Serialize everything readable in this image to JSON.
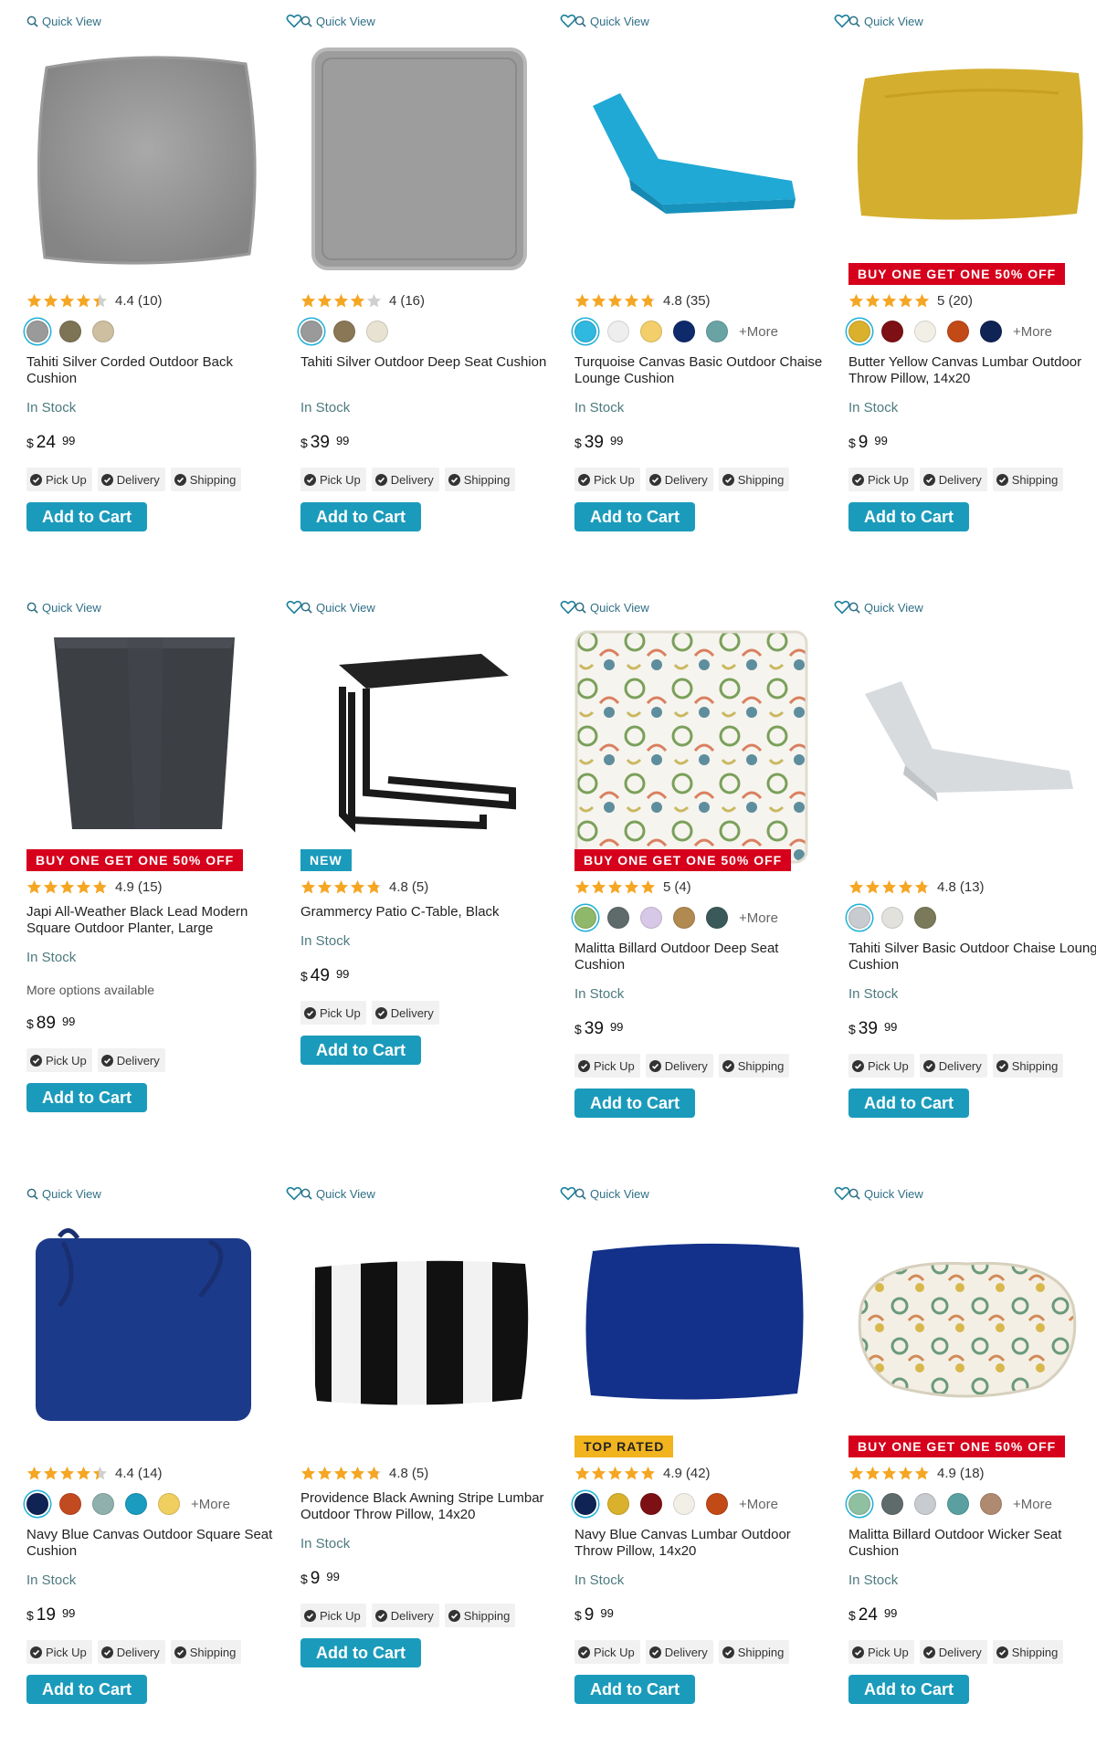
{
  "common": {
    "quick_view": "Quick View",
    "add_to_cart": "Add to Cart",
    "more_link": "+More",
    "in_stock": "In Stock",
    "currency": "$",
    "pick_up": "Pick Up",
    "delivery": "Delivery",
    "shipping": "Shipping"
  },
  "colors": {
    "accent": "#1b9bbb",
    "link": "#2f6f86",
    "badge_red": "#d6001c",
    "badge_gold": "#f2b41e",
    "star": "#f5a623"
  },
  "products": [
    {
      "name": "Tahiti Silver Corded Outdoor Back Cushion",
      "rating": 4.4,
      "rating_text": "4.4",
      "reviews": "(10)",
      "badge": "",
      "swatches": [
        "#9a9a9a",
        "#7d7456",
        "#cdbf9f"
      ],
      "has_more": false,
      "stock": "In Stock",
      "extra": "",
      "price_dollars": "24",
      "price_cents": "99",
      "fulfillment": [
        "pick_up",
        "delivery",
        "shipping"
      ],
      "icon": "silver-cushion-image"
    },
    {
      "name": "Tahiti Silver Outdoor Deep Seat Cushion",
      "rating": 4.0,
      "rating_text": "4",
      "reviews": "(16)",
      "badge": "",
      "swatches": [
        "#9a9a9a",
        "#8a7756",
        "#e8e2d2"
      ],
      "has_more": false,
      "stock": "In Stock",
      "extra": "",
      "price_dollars": "39",
      "price_cents": "99",
      "fulfillment": [
        "pick_up",
        "delivery",
        "shipping"
      ],
      "icon": "seat-cushion-image"
    },
    {
      "name": "Turquoise Canvas Basic Outdoor Chaise Lounge Cushion",
      "rating": 4.8,
      "rating_text": "4.8",
      "reviews": "(35)",
      "badge": "",
      "swatches": [
        "#2fb8e0",
        "#eeeeee",
        "#f2cf6a",
        "#0f2a6b",
        "#6aa3a3"
      ],
      "has_more": true,
      "stock": "In Stock",
      "extra": "",
      "price_dollars": "39",
      "price_cents": "99",
      "fulfillment": [
        "pick_up",
        "delivery",
        "shipping"
      ],
      "icon": "chaise-cushion-image"
    },
    {
      "name": "Butter Yellow Canvas Lumbar Outdoor Throw Pillow, 14x20",
      "rating": 5.0,
      "rating_text": "5",
      "reviews": "(20)",
      "badge": "BUY ONE GET ONE 50% OFF",
      "badge_style": "red",
      "swatches": [
        "#d9b12c",
        "#7d1014",
        "#f2f0e6",
        "#c24a17",
        "#0f2354"
      ],
      "has_more": true,
      "stock": "In Stock",
      "extra": "",
      "price_dollars": "9",
      "price_cents": "99",
      "fulfillment": [
        "pick_up",
        "delivery",
        "shipping"
      ],
      "icon": "lumbar-pillow-image"
    },
    {
      "name": "Japi All-Weather Black Lead Modern Square Outdoor Planter, Large",
      "rating": 4.9,
      "rating_text": "4.9",
      "reviews": "(15)",
      "badge": "BUY ONE GET ONE 50% OFF",
      "badge_style": "red",
      "swatches": [],
      "has_more": false,
      "stock": "In Stock",
      "extra": "More options available",
      "price_dollars": "89",
      "price_cents": "99",
      "fulfillment": [
        "pick_up",
        "delivery"
      ],
      "icon": "planter-image"
    },
    {
      "name": "Grammercy Patio C-Table, Black",
      "rating": 4.8,
      "rating_text": "4.8",
      "reviews": "(5)",
      "badge": "NEW",
      "badge_style": "teal",
      "swatches": [],
      "has_more": false,
      "stock": "In Stock",
      "extra": "",
      "price_dollars": "49",
      "price_cents": "99",
      "fulfillment": [
        "pick_up",
        "delivery"
      ],
      "icon": "c-table-image"
    },
    {
      "name": "Malitta Billard Outdoor Deep Seat Cushion",
      "rating": 5.0,
      "rating_text": "5",
      "reviews": "(4)",
      "badge": "BUY ONE GET ONE 50% OFF",
      "badge_style": "red",
      "swatches": [
        "#8fb86a",
        "#5f6b6b",
        "#d8c8e8",
        "#b08a50",
        "#3a5a5a"
      ],
      "has_more": true,
      "stock": "In Stock",
      "extra": "",
      "price_dollars": "39",
      "price_cents": "99",
      "fulfillment": [
        "pick_up",
        "delivery",
        "shipping"
      ],
      "icon": "pattern-cushion-image"
    },
    {
      "name": "Tahiti Silver Basic Outdoor Chaise Lounge Cushion",
      "rating": 4.8,
      "rating_text": "4.8",
      "reviews": "(13)",
      "badge": "",
      "swatches": [
        "#c8ccd0",
        "#e2e1dc",
        "#7a7a5a"
      ],
      "has_more": false,
      "stock": "In Stock",
      "extra": "",
      "price_dollars": "39",
      "price_cents": "99",
      "fulfillment": [
        "pick_up",
        "delivery",
        "shipping"
      ],
      "icon": "silver-chaise-image"
    },
    {
      "name": "Navy Blue Canvas Outdoor Square Seat Cushion",
      "rating": 4.4,
      "rating_text": "4.4",
      "reviews": "(14)",
      "badge": "",
      "swatches": [
        "#0f2354",
        "#c24a20",
        "#8fb0ac",
        "#1a9bc0",
        "#f0cf60"
      ],
      "has_more": true,
      "stock": "In Stock",
      "extra": "",
      "price_dollars": "19",
      "price_cents": "99",
      "fulfillment": [
        "pick_up",
        "delivery",
        "shipping"
      ],
      "icon": "navy-cushion-image"
    },
    {
      "name": "Providence Black Awning Stripe Lumbar Outdoor Throw Pillow, 14x20",
      "rating": 4.8,
      "rating_text": "4.8",
      "reviews": "(5)",
      "badge": "",
      "swatches": [],
      "has_more": false,
      "stock": "In Stock",
      "extra": "",
      "price_dollars": "9",
      "price_cents": "99",
      "fulfillment": [
        "pick_up",
        "delivery",
        "shipping"
      ],
      "icon": "stripe-pillow-image"
    },
    {
      "name": "Navy Blue Canvas Lumbar Outdoor Throw Pillow, 14x20",
      "rating": 4.9,
      "rating_text": "4.9",
      "reviews": "(42)",
      "badge": "TOP RATED",
      "badge_style": "gold",
      "swatches": [
        "#0f2354",
        "#d9b12c",
        "#7d1014",
        "#f2f0e6",
        "#c24a17"
      ],
      "has_more": true,
      "stock": "In Stock",
      "extra": "",
      "price_dollars": "9",
      "price_cents": "99",
      "fulfillment": [
        "pick_up",
        "delivery",
        "shipping"
      ],
      "icon": "navy-pillow-image"
    },
    {
      "name": "Malitta Billard Outdoor Wicker Seat Cushion",
      "rating": 4.9,
      "rating_text": "4.9",
      "reviews": "(18)",
      "badge": "BUY ONE GET ONE 50% OFF",
      "badge_style": "red",
      "swatches": [
        "#8fc0a0",
        "#5f6b6b",
        "#c8ccd0",
        "#5aa0a0",
        "#b08a70"
      ],
      "has_more": true,
      "stock": "In Stock",
      "extra": "",
      "price_dollars": "24",
      "price_cents": "99",
      "fulfillment": [
        "pick_up",
        "delivery",
        "shipping"
      ],
      "icon": "wicker-cushion-image"
    }
  ]
}
